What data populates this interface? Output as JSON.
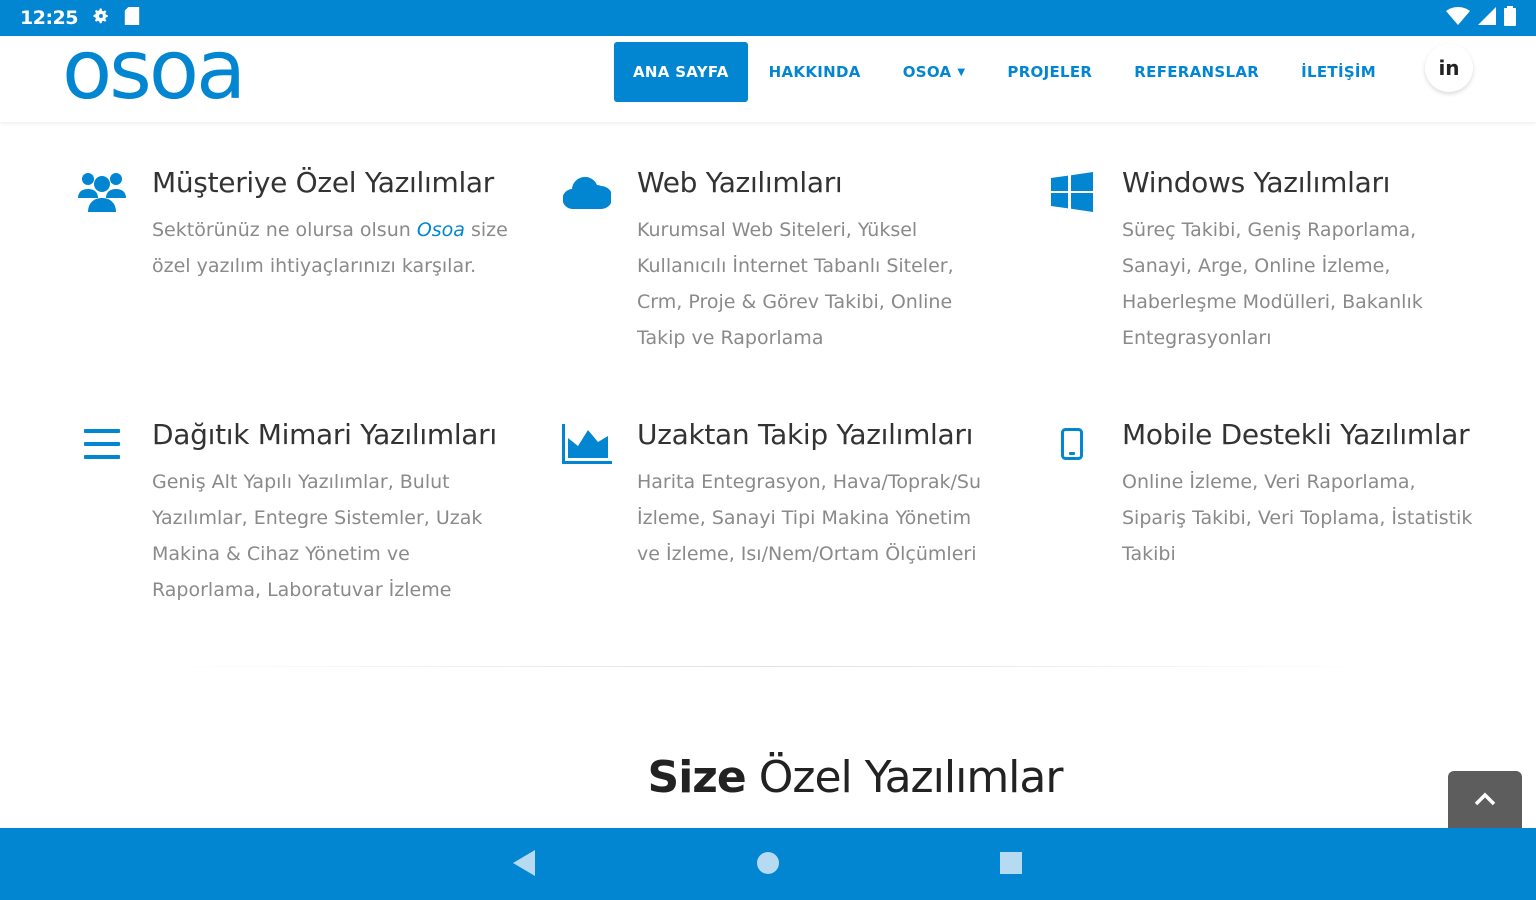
{
  "status_bar": {
    "time": "12:25",
    "left_icons": [
      "gear-icon",
      "sd-card-icon"
    ],
    "right_icons": [
      "wifi-icon",
      "signal-icon",
      "battery-icon"
    ]
  },
  "brand": {
    "logo_text": "osoa",
    "color": "#0386d1"
  },
  "navbar": {
    "items": [
      {
        "label": "ANA SAYFA",
        "active": true
      },
      {
        "label": "HAKKINDA",
        "active": false
      },
      {
        "label": "OSOA",
        "active": false,
        "dropdown": true
      },
      {
        "label": "PROJELER",
        "active": false
      },
      {
        "label": "REFERANSLAR",
        "active": false
      },
      {
        "label": "İLETİŞİM",
        "active": false
      }
    ],
    "social": "in"
  },
  "features": [
    {
      "icon": "users-icon",
      "title": "Müşteriye Özel Yazılımlar",
      "desc_before": "Sektörünüz ne olursa olsun ",
      "desc_brand": "Osoa",
      "desc_after": " size özel yazılım ihtiyaçlarınızı karşılar."
    },
    {
      "icon": "cloud-icon",
      "title": "Web Yazılımları",
      "desc": "Kurumsal Web Siteleri, Yüksel Kullanıcılı İnternet Tabanlı Siteler, Crm, Proje & Görev Takibi, Online Takip ve Raporlama"
    },
    {
      "icon": "windows-icon",
      "title": "Windows Yazılımları",
      "desc": "Süreç Takibi, Geniş Raporlama, Sanayi, Arge, Online İzleme, Haberleşme Modülleri, Bakanlık Entegrasyonları"
    },
    {
      "icon": "menu-lines-icon",
      "title": "Dağıtık Mimari Yazılımları",
      "desc": "Geniş Alt Yapılı Yazılımlar, Bulut Yazılımlar, Entegre Sistemler, Uzak Makina & Cihaz Yönetim ve Raporlama, Laboratuvar İzleme"
    },
    {
      "icon": "area-chart-icon",
      "title": "Uzaktan Takip Yazılımları",
      "desc": "Harita Entegrasyon, Hava/Toprak/Su İzleme, Sanayi Tipi Makina Yönetim ve İzleme, Isı/Nem/Ortam Ölçümleri"
    },
    {
      "icon": "mobile-icon",
      "title": "Mobile Destekli Yazılımlar",
      "desc": "Online İzleme, Veri Raporlama, Sipariş Takibi, Veri Toplama, İstatistik Takibi"
    }
  ],
  "section": {
    "title_bold": "Size",
    "title_light": " Özel Yazılımlar"
  },
  "android_nav": {
    "buttons": [
      "back-icon",
      "home-icon",
      "recents-icon"
    ]
  }
}
